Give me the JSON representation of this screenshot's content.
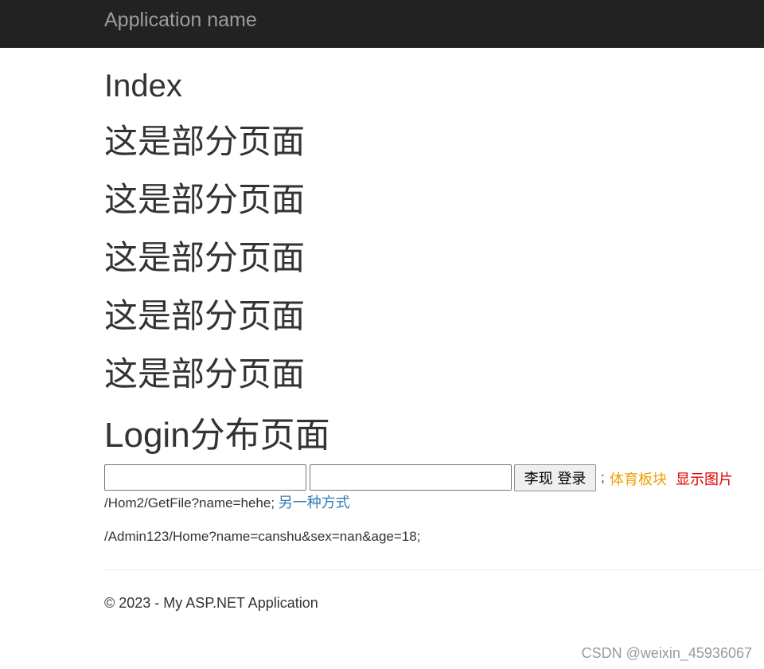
{
  "navbar": {
    "brand": "Application name"
  },
  "page": {
    "title": "Index",
    "partials": [
      "这是部分页面",
      "这是部分页面",
      "这是部分页面",
      "这是部分页面",
      "这是部分页面"
    ],
    "login_title": "Login分布页面"
  },
  "form": {
    "input1_value": "",
    "input2_value": "",
    "login_button": "李现 登录",
    "separator": ";",
    "sports_link": "体育板块",
    "image_link": "显示图片"
  },
  "urls": {
    "get_file": "/Hom2/GetFile?name=hehe;",
    "alt_link": "另一种方式",
    "admin": "/Admin123/Home?name=canshu&sex=nan&age=18;"
  },
  "footer": {
    "text": "© 2023 - My ASP.NET Application"
  },
  "watermark": {
    "text": "CSDN @weixin_45936067"
  },
  "colors": {
    "navbar_bg": "#222222",
    "brand": "#9d9d9d",
    "sports_link": "#f0a000",
    "image_link": "#dd0000",
    "alt_link": "#337ab7"
  }
}
